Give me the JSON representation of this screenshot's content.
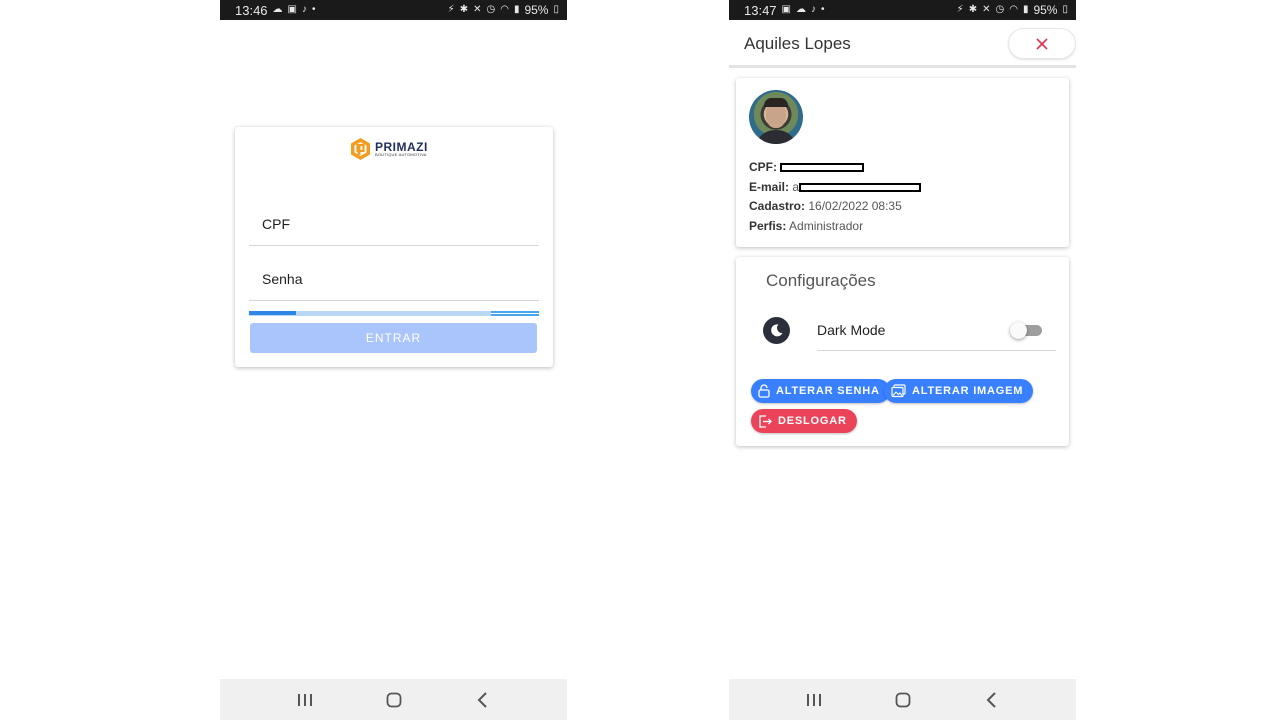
{
  "left_screen": {
    "statusbar": {
      "time": "13:46",
      "battery": "95%"
    },
    "logo": {
      "name": "PRIMAZI",
      "tagline": "BOUTIQUE AUTOMOTIVA"
    },
    "form": {
      "cpf_placeholder": "CPF",
      "senha_placeholder": "Senha",
      "submit_label": "ENTRAR"
    }
  },
  "right_screen": {
    "statusbar": {
      "time": "13:47",
      "battery": "95%"
    },
    "header": {
      "title": "Aquiles Lopes",
      "close_icon": "close-icon"
    },
    "profile": {
      "cpf_label": "CPF:",
      "email_label": "E-mail:",
      "email_partial": "a",
      "cadastro_label": "Cadastro:",
      "cadastro_value": "16/02/2022 08:35",
      "perfis_label": "Perfis:",
      "perfis_value": "Administrador"
    },
    "config": {
      "title": "Configurações",
      "dark_mode_label": "Dark Mode",
      "dark_mode_enabled": false,
      "buttons": {
        "alterar_senha": "ALTERAR SENHA",
        "alterar_imagem": "ALTERAR IMAGEM",
        "deslogar": "DESLOGAR"
      }
    },
    "colors": {
      "primary": "#3880ff",
      "danger": "#eb445a"
    }
  }
}
